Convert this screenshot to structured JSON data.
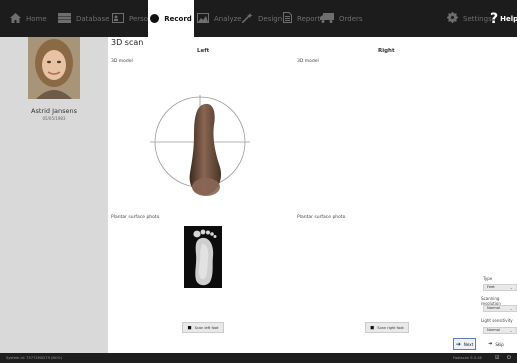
{
  "nav": {
    "home": "Home",
    "database": "Database",
    "person": "Person",
    "record": "Record",
    "analyze": "Analyze",
    "design": "Design",
    "report": "Report",
    "orders": "Orders",
    "settings": "Settings",
    "help": "Help"
  },
  "patient": {
    "name": "Astrid Jansens",
    "dob": "05/05/1983"
  },
  "main": {
    "title": "3D scan",
    "left_label": "Left",
    "right_label": "Right",
    "model_label_left": "3D model",
    "model_label_right": "3D model",
    "plantar_label_left": "Plantar surface photo",
    "plantar_label_right": "Plantar surface photo",
    "scan_left": "Scan left foot",
    "scan_right": "Scan right foot"
  },
  "controls": {
    "type_label": "Type",
    "type_value": "Feet",
    "resolution_label": "Scanning resolution",
    "resolution_value": "Normal",
    "sensitivity_label": "Light sensitivity",
    "sensitivity_value": "Normal",
    "next": "Next",
    "skip": "Skip"
  },
  "status": {
    "system_id": "System id: 75772M0279 (BOO)",
    "version": "Footscan 9.3.16"
  },
  "colors": {
    "topbar": "#1c1c1c",
    "panel": "#d9d9d9",
    "accent_border": "#5a7fb5"
  }
}
